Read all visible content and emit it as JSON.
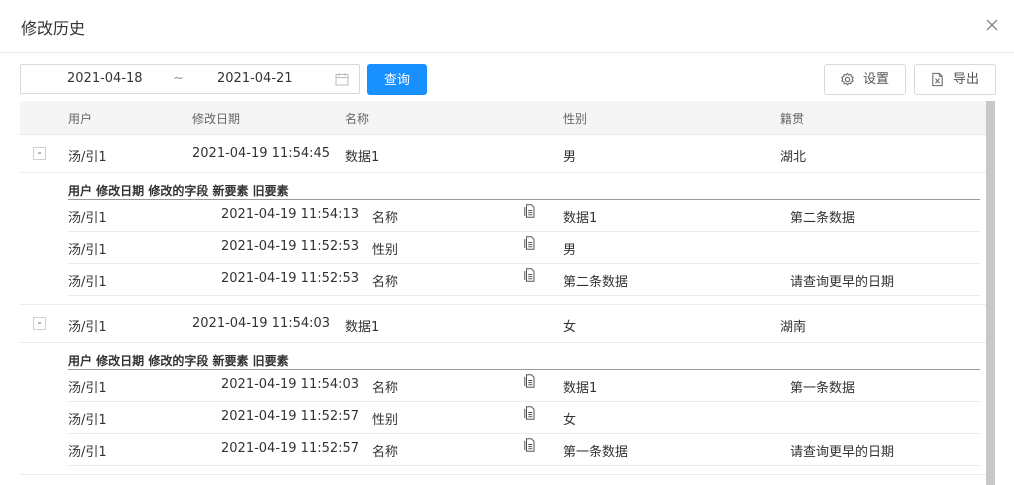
{
  "dialog": {
    "title": "修改历史"
  },
  "filter": {
    "start_date": "2021-04-18",
    "separator": "~",
    "end_date": "2021-04-21",
    "query_label": "查询",
    "settings_label": "设置",
    "export_label": "导出"
  },
  "colors": {
    "primary": "#1890ff",
    "header_bg": "#f5f5f5"
  },
  "main_columns": [
    "用户",
    "修改日期",
    "名称",
    "性别",
    "籍贯"
  ],
  "sub_columns": [
    "用户",
    "修改日期",
    "修改的字段",
    "新要素",
    "旧要素"
  ],
  "records": [
    {
      "expander": "-",
      "user": "汤/引1",
      "date": "2021-04-19 11:54:45",
      "name": "数据1",
      "gender": "男",
      "origin": "湖北",
      "changes": [
        {
          "user": "汤/引1",
          "date": "2021-04-19 11:54:13",
          "field": "名称",
          "new": "数据1",
          "old": "第二条数据"
        },
        {
          "user": "汤/引1",
          "date": "2021-04-19 11:52:53",
          "field": "性别",
          "new": "男",
          "old": ""
        },
        {
          "user": "汤/引1",
          "date": "2021-04-19 11:52:53",
          "field": "名称",
          "new": "第二条数据",
          "old": "请查询更早的日期"
        }
      ]
    },
    {
      "expander": "-",
      "user": "汤/引1",
      "date": "2021-04-19 11:54:03",
      "name": "数据1",
      "gender": "女",
      "origin": "湖南",
      "changes": [
        {
          "user": "汤/引1",
          "date": "2021-04-19 11:54:03",
          "field": "名称",
          "new": "数据1",
          "old": "第一条数据"
        },
        {
          "user": "汤/引1",
          "date": "2021-04-19 11:52:57",
          "field": "性别",
          "new": "女",
          "old": ""
        },
        {
          "user": "汤/引1",
          "date": "2021-04-19 11:52:57",
          "field": "名称",
          "new": "第一条数据",
          "old": "请查询更早的日期"
        }
      ]
    }
  ]
}
